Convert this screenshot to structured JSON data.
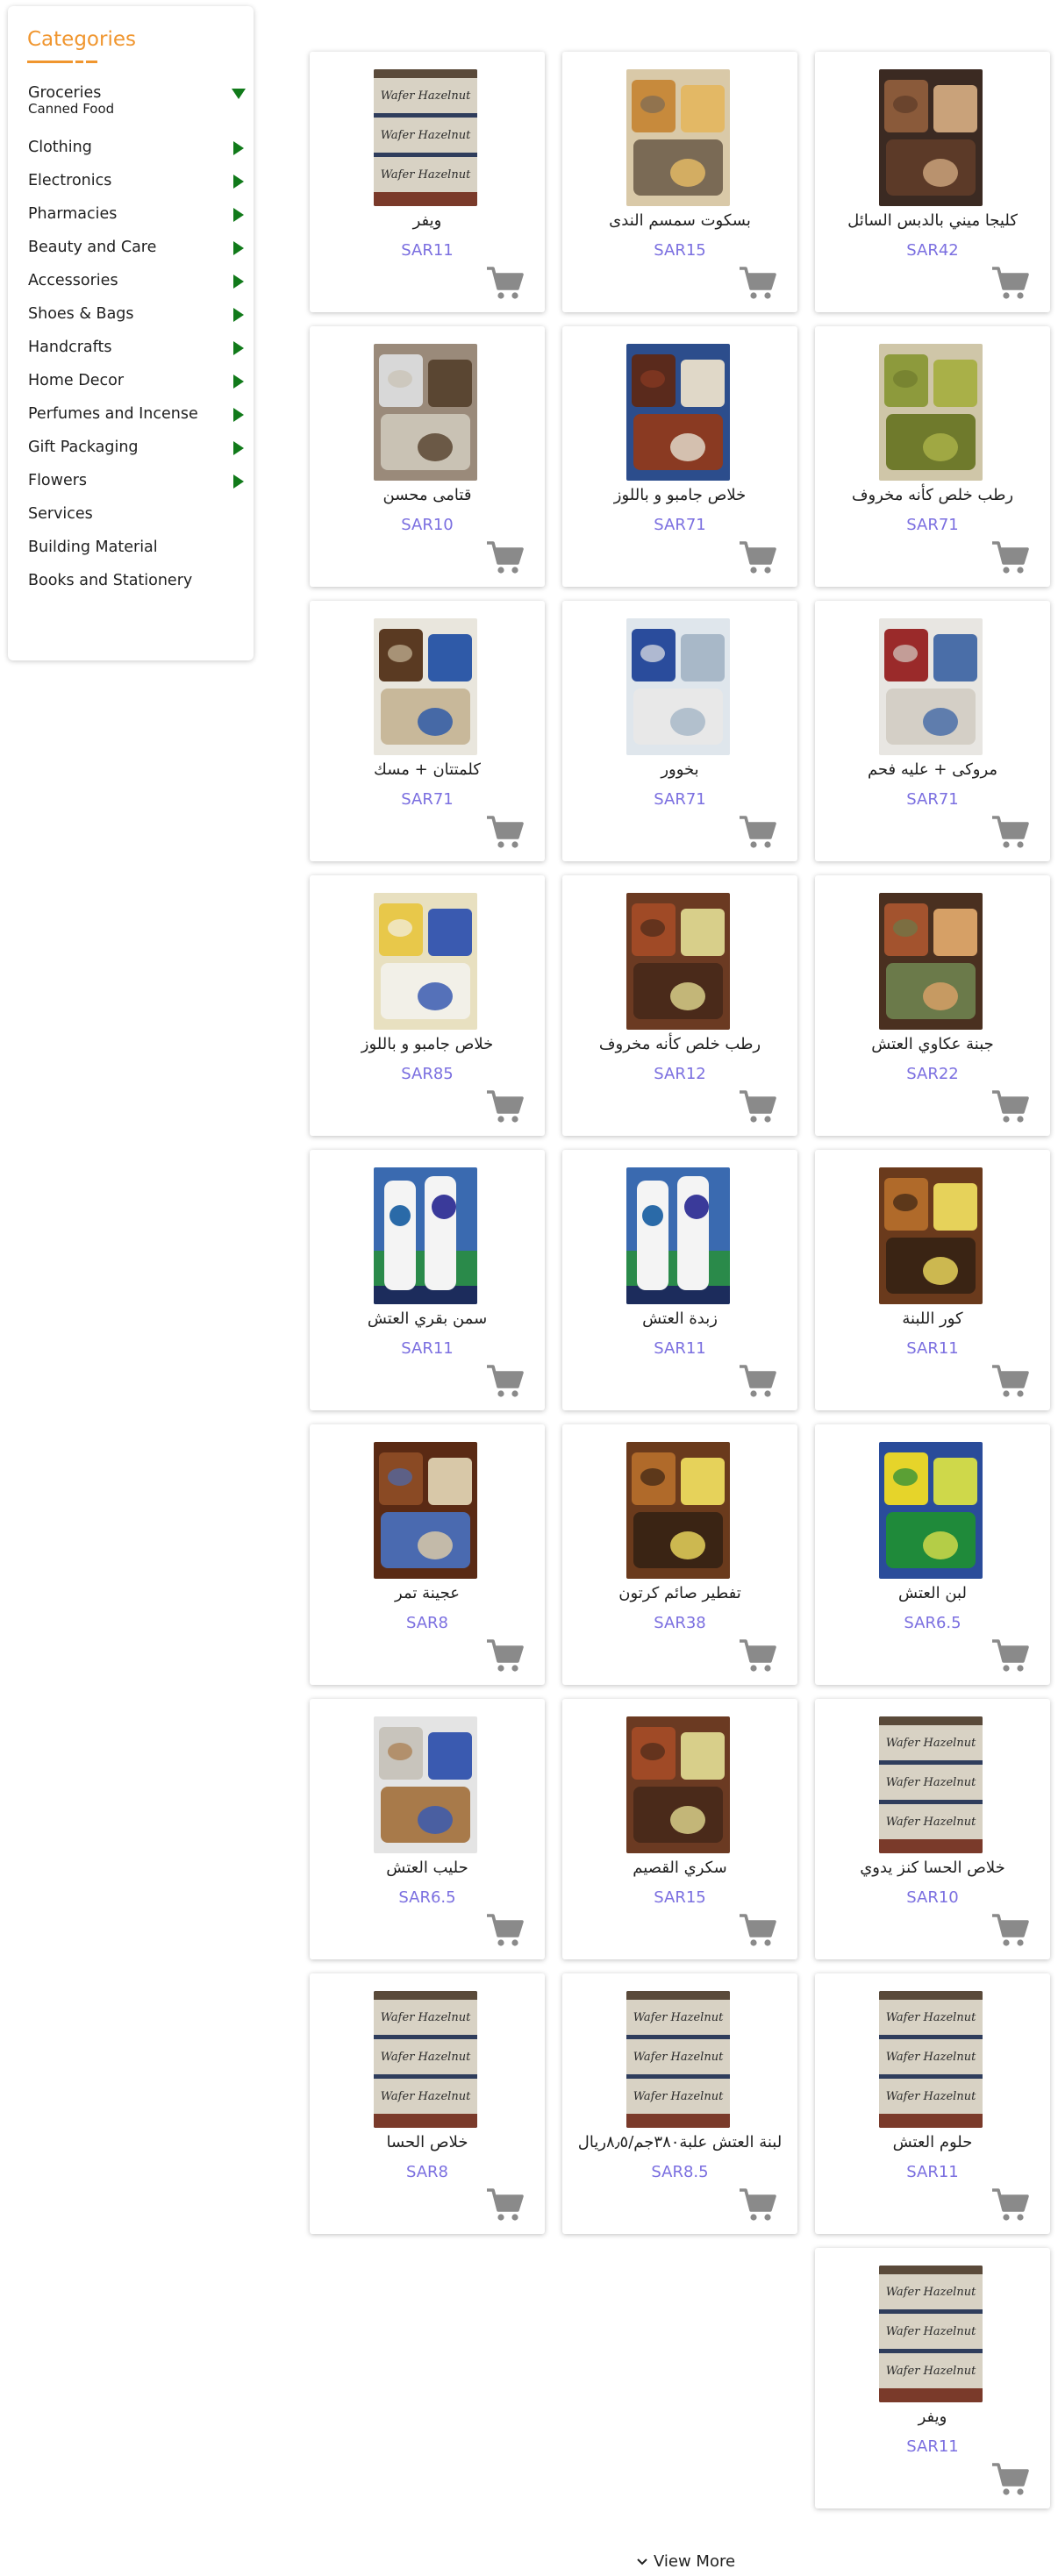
{
  "sidebar": {
    "title": "Categories",
    "items": [
      {
        "label": "Groceries",
        "sub": "Canned Food",
        "arrow": "down"
      },
      {
        "label": "Clothing",
        "arrow": "right"
      },
      {
        "label": "Electronics",
        "arrow": "right"
      },
      {
        "label": "Pharmacies",
        "arrow": "right"
      },
      {
        "label": "Beauty and Care",
        "arrow": "right"
      },
      {
        "label": "Accessories",
        "arrow": "right"
      },
      {
        "label": "Shoes & Bags",
        "arrow": "right"
      },
      {
        "label": "Handcrafts",
        "arrow": "right"
      },
      {
        "label": "Home Decor",
        "arrow": "right"
      },
      {
        "label": "Perfumes and Incense",
        "arrow": "right"
      },
      {
        "label": "Gift Packaging",
        "arrow": "right"
      },
      {
        "label": "Flowers",
        "arrow": "right"
      },
      {
        "label": "Services",
        "arrow": ""
      },
      {
        "label": "Building Material",
        "arrow": ""
      },
      {
        "label": "Books and Stationery",
        "arrow": ""
      }
    ]
  },
  "products": [
    {
      "name": "كليجا ميني بالدبس السائل",
      "price": "SAR42",
      "img": "pastries"
    },
    {
      "name": "بسكوت سمسم الندى",
      "price": "SAR15",
      "img": "biscuits"
    },
    {
      "name": "ويفر",
      "price": "SAR11",
      "img": "wafer"
    },
    {
      "name": "رطب خلص كأنه مخروف",
      "price": "SAR71",
      "img": "green-dates"
    },
    {
      "name": "خلاص جامبو و باللوز",
      "price": "SAR71",
      "img": "dates-box"
    },
    {
      "name": "قتامى محسن",
      "price": "SAR10",
      "img": "bags"
    },
    {
      "name": "مروكى + عليه فحم",
      "price": "SAR71",
      "img": "bucket"
    },
    {
      "name": "بخوور",
      "price": "SAR71",
      "img": "jar"
    },
    {
      "name": "كلمتتان + مسك",
      "price": "SAR71",
      "img": "tub"
    },
    {
      "name": "جبنة عكاوي العتش",
      "price": "SAR22",
      "img": "pastries2"
    },
    {
      "name": "رطب خلص كأنه مخروف",
      "price": "SAR12",
      "img": "packs"
    },
    {
      "name": "خلاص جامبو و باللوز",
      "price": "SAR85",
      "img": "jar-yellow"
    },
    {
      "name": "كور اللبنة",
      "price": "SAR11",
      "img": "dates-pack"
    },
    {
      "name": "زبدة العتش",
      "price": "SAR11",
      "img": "milk"
    },
    {
      "name": "سمن بقري العتش",
      "price": "SAR11",
      "img": "milk"
    },
    {
      "name": "لبن العتش",
      "price": "SAR6.5",
      "img": "yellow-tubs"
    },
    {
      "name": "تفطير صائم كرتون",
      "price": "SAR38",
      "img": "dates-pack"
    },
    {
      "name": "عجينة تمر",
      "price": "SAR8",
      "img": "dates-tray"
    },
    {
      "name": "خلاص الحسا كنز يدوي",
      "price": "SAR10",
      "img": "wafer"
    },
    {
      "name": "سكري القصيم",
      "price": "SAR15",
      "img": "packs"
    },
    {
      "name": "حليب العتش",
      "price": "SAR6.5",
      "img": "tub2"
    },
    {
      "name": "حلوم العتش",
      "price": "SAR11",
      "img": "wafer"
    },
    {
      "name": "لبنة العتش علبة٣٨٠جم/٨٫٥ريال",
      "price": "SAR8.5",
      "img": "wafer"
    },
    {
      "name": "خلاص الحسا",
      "price": "SAR8",
      "img": "wafer"
    },
    {
      "name": "ويفر",
      "price": "SAR11",
      "img": "wafer"
    }
  ],
  "view_more_label": "View More",
  "colors": {
    "accent": "#f0962f",
    "price": "#7b6fe0",
    "arrow": "#117a1a",
    "cart": "#8a8a8a"
  }
}
